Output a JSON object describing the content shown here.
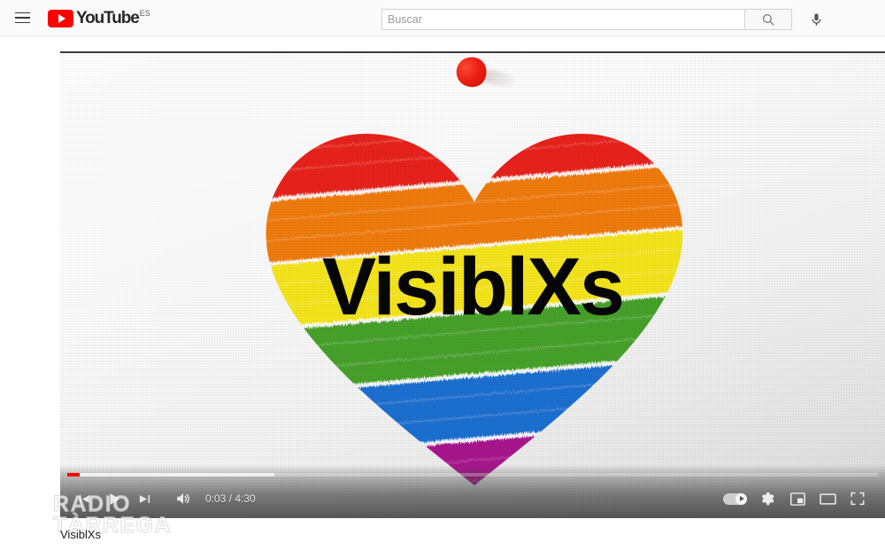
{
  "header": {
    "guide_button": "Menú de guía",
    "logo": {
      "icon": "youtube-play-icon",
      "wordmark": "YouTube",
      "country_code": "ES"
    },
    "search": {
      "value": "",
      "placeholder": "Buscar",
      "submit_icon": "search-icon",
      "mic_icon": "microphone-icon"
    }
  },
  "player": {
    "video_title": "VisiblXs",
    "poster": {
      "overlay_text": "VisiblXs",
      "description": "rainbow-painted-heart",
      "heart_stripes": [
        {
          "name": "red",
          "color": "#e8241c"
        },
        {
          "name": "orange",
          "color": "#f07c11"
        },
        {
          "name": "yellow",
          "color": "#f5e51a"
        },
        {
          "name": "green",
          "color": "#46a12c"
        },
        {
          "name": "blue",
          "color": "#1f6fd0"
        },
        {
          "name": "purple",
          "color": "#a8128d"
        }
      ],
      "paint_blob_color": "#e8241c",
      "canvas_color": "#f2f2f2"
    },
    "progress": {
      "played_percent": 1.55,
      "loaded_percent": 25.6,
      "played_color": "#ff0000"
    },
    "controls": {
      "previous_icon": "previous-track-icon",
      "play_icon": "play-icon",
      "next_icon": "next-track-icon",
      "volume_icon": "volume-high-icon",
      "time": "0:03 / 4:30",
      "current_time": "0:03",
      "duration": "4:30",
      "autoplay_icon": "autoplay-toggle-icon",
      "autoplay_state": "on",
      "settings_icon": "gear-icon",
      "miniplayer_icon": "miniplayer-icon",
      "theater_icon": "theater-mode-icon",
      "fullscreen_icon": "fullscreen-icon"
    }
  },
  "watermark": {
    "logo_icon": "vintage-microphone-icon",
    "line1": "RADIO",
    "line2": "TÀRREGA"
  }
}
